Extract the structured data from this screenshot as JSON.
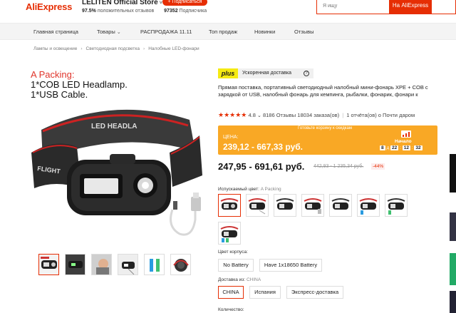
{
  "header": {
    "logo": "AliExpress",
    "store_name": "LELITEN Official Store",
    "follow_label": "+ Подписаться",
    "positive_pct": "97.5%",
    "positive_label": "положительных отзывов",
    "subscribers": "97352",
    "subscribers_label": "Подписчика",
    "search_placeholder": "Я ищу",
    "search_button": "На AliExpress"
  },
  "nav": {
    "items": [
      "Главная страница",
      "Товары",
      "РАСПРОДАЖА 11.11",
      "Топ продаж",
      "Новинки",
      "Отзывы"
    ]
  },
  "breadcrumb": [
    "Лампы и освещение",
    "Светодиодная подсветка",
    "Налобные LED-фонари"
  ],
  "gallery": {
    "title_red": "A Packing:",
    "title_line2": "1*COB LED Headlamp.",
    "title_line3": "1*USB Cable.",
    "headband_text": "LED HEADLA",
    "headband_text2": "FLIGHT",
    "thumb_count": 6
  },
  "product": {
    "plus_badge": "plus",
    "delivery_label": "Ускоренная доставка",
    "title": "Прямая поставка, портативный светодиодный налобный мини-фонарь XPE + COB с зарядкой от USB, налобный фонарь для кемпинга, рыбалки, фонарик, фонари к",
    "rating": "4.8",
    "reviews": "8186 Отзывы",
    "orders": "18034 заказа(ов)",
    "reports": "1 отчёта(ов) о Почти даром",
    "banner_top": "Готовьте корзину к скидкам",
    "price_label": "ЦЕНА:",
    "price_range": "239,12 - 667,33 руб.",
    "start_label": "Начало",
    "countdown": [
      "8",
      "22",
      "12",
      "32"
    ],
    "countdown_sep": "д",
    "price_main": "247,95 - 691,61 руб.",
    "price_old": "442,93 - 1 235,34 руб.",
    "discount": "-44%"
  },
  "options": {
    "color_label": "Испускаемый цвет:",
    "color_value": "A Packing",
    "color_count": 8,
    "body_color_label": "Цвет корпуса:",
    "body_colors": [
      "No Battery",
      "Have 1x18650 Battery"
    ],
    "ship_from_label": "Доставка из:",
    "ship_from_value": "CHINA",
    "ship_from": [
      "CHINA",
      "Испания",
      "Экспресс-доставка"
    ],
    "quantity_label": "Количество:"
  },
  "colors": {
    "brand": "#e62e04",
    "banner": "#f9a825",
    "plus": "#f5ea12"
  }
}
